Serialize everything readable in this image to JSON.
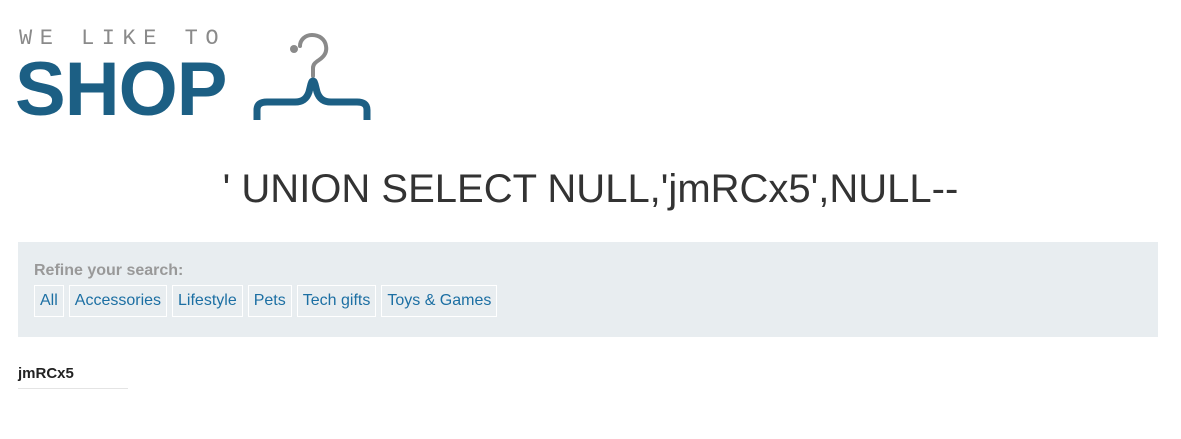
{
  "logo": {
    "tagline": "WE LIKE TO",
    "wordmark": "SHOP"
  },
  "heading": "' UNION SELECT NULL,'jmRCx5',NULL--",
  "filters": {
    "label": "Refine your search:",
    "items": [
      {
        "label": "All"
      },
      {
        "label": "Accessories"
      },
      {
        "label": "Lifestyle"
      },
      {
        "label": "Pets"
      },
      {
        "label": "Tech gifts"
      },
      {
        "label": "Toys & Games"
      }
    ]
  },
  "results": [
    {
      "text": "jmRCx5"
    }
  ],
  "colors": {
    "brand_blue": "#1c5f84",
    "link_blue": "#1c6fa3",
    "panel_bg": "#e8edf0",
    "hanger_hook": "#8a8a8a"
  }
}
